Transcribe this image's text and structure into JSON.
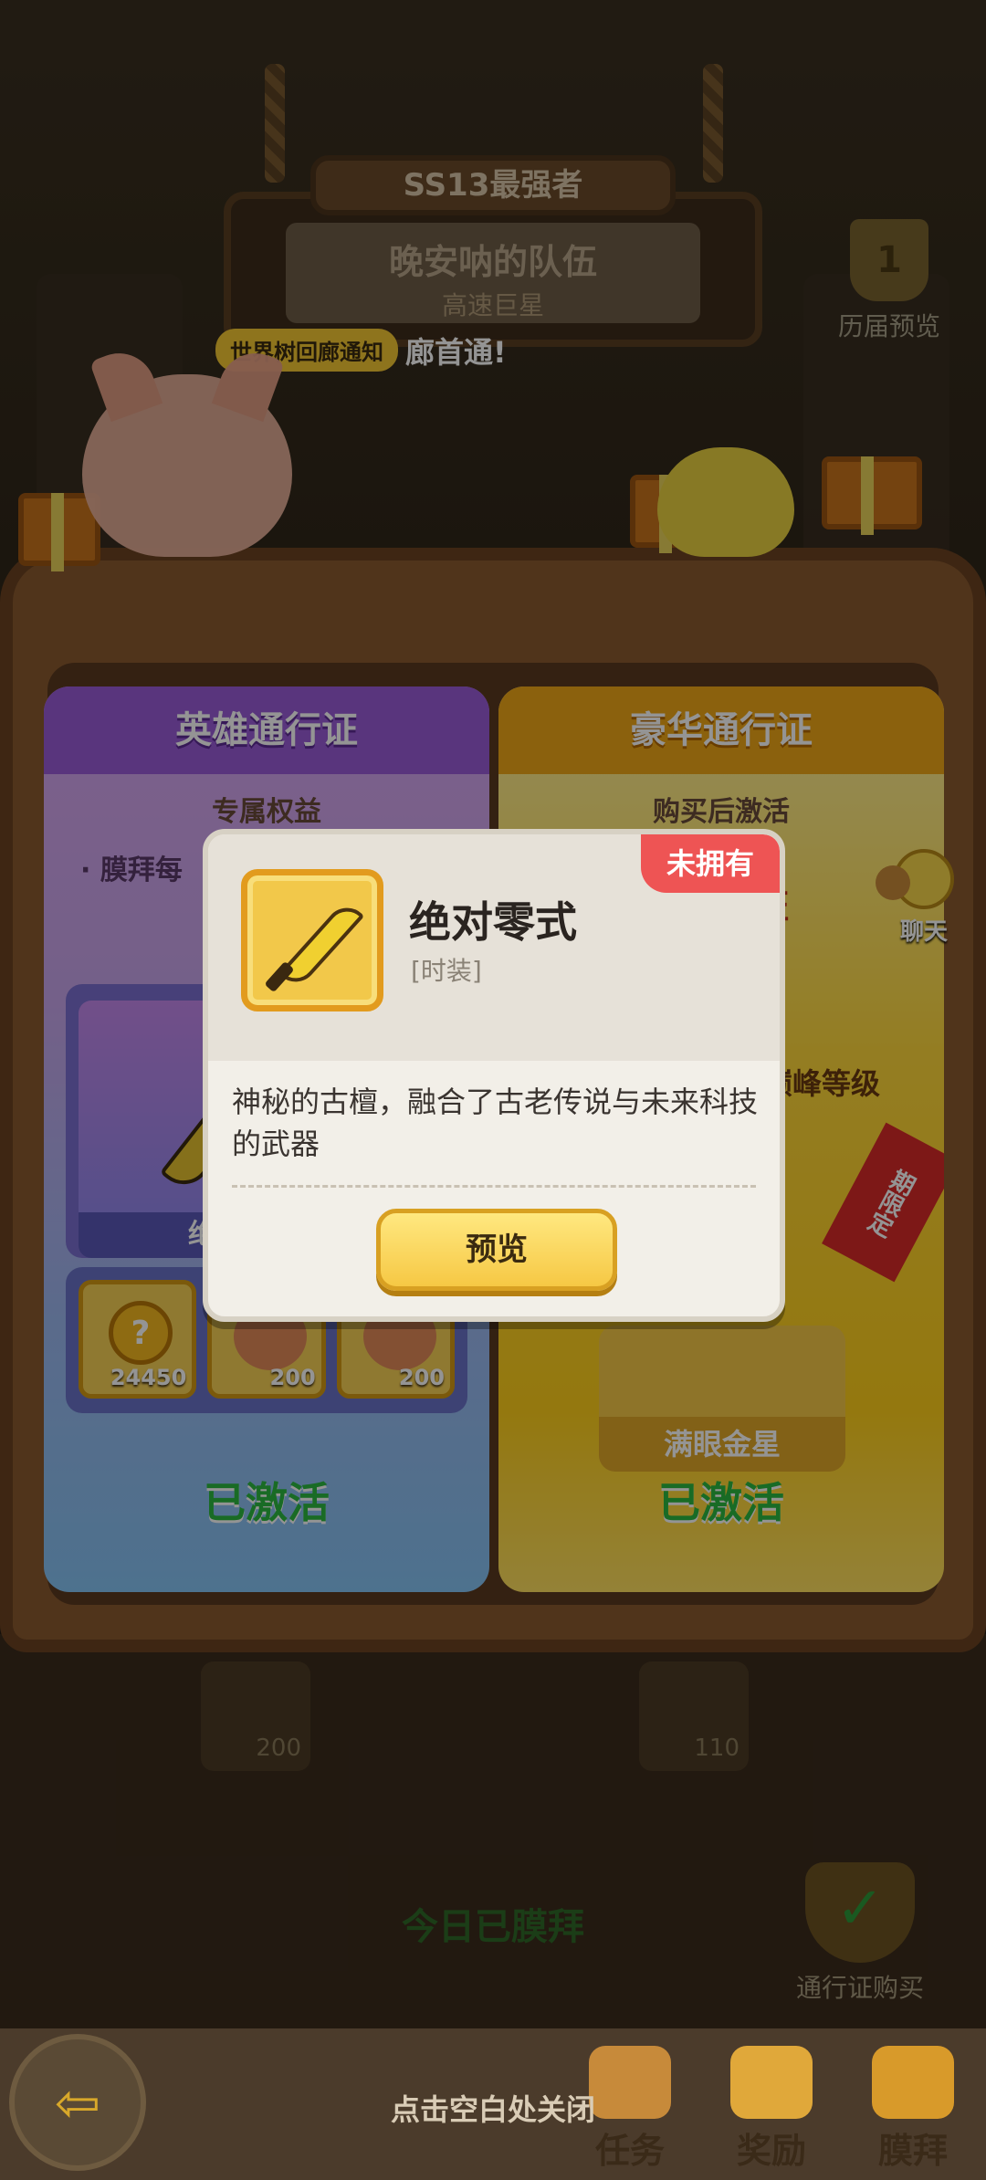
{
  "header": {
    "title": "SS13最强者",
    "team_name": "晚安呐的队伍",
    "team_subtitle": "高速巨星",
    "notification_tag": "世界树回廊通知",
    "notification_message": "廊首通!",
    "history_label": "历届预览",
    "history_rank": "1"
  },
  "passes": {
    "hero": {
      "title": "英雄通行证",
      "subtitle": "专属权益",
      "bullet": "· 膜拜每",
      "reward_label": "绝对",
      "items": [
        {
          "count": "24450",
          "icon": "coin-icon"
        },
        {
          "count": "200",
          "icon": "avatar-icon"
        },
        {
          "count": "200",
          "icon": "avatar-icon"
        }
      ],
      "status": "已激活"
    },
    "luxury": {
      "title": "豪华通行证",
      "subtitle": "购买后激活",
      "tag": "证",
      "line": "巅峰等级",
      "ribbon": "期限定",
      "reward_label": "满眼金星",
      "status": "已激活"
    }
  },
  "below": {
    "slot_left_count": "200",
    "slot_right_count": "110",
    "today_status": "今日已膜拜",
    "pass_buy_label": "通行证购买"
  },
  "chat": {
    "label": "聊天"
  },
  "popup": {
    "owned_badge": "未拥有",
    "item_name": "绝对零式",
    "item_type": "[时装]",
    "description": "神秘的古檀，融合了古老传说与未来科技的武器",
    "preview_button": "预览"
  },
  "bottom_bar": {
    "close_hint": "点击空白处关闭",
    "tabs": [
      {
        "label": "任务",
        "icon": "task-icon"
      },
      {
        "label": "奖励",
        "icon": "reward-icon"
      },
      {
        "label": "膜拜",
        "icon": "worship-icon"
      }
    ]
  },
  "colors": {
    "hero_header": "#9a5cd8",
    "luxury_header": "#f0a818",
    "owned_badge": "#ee5454",
    "activated_green": "#2cb840"
  }
}
